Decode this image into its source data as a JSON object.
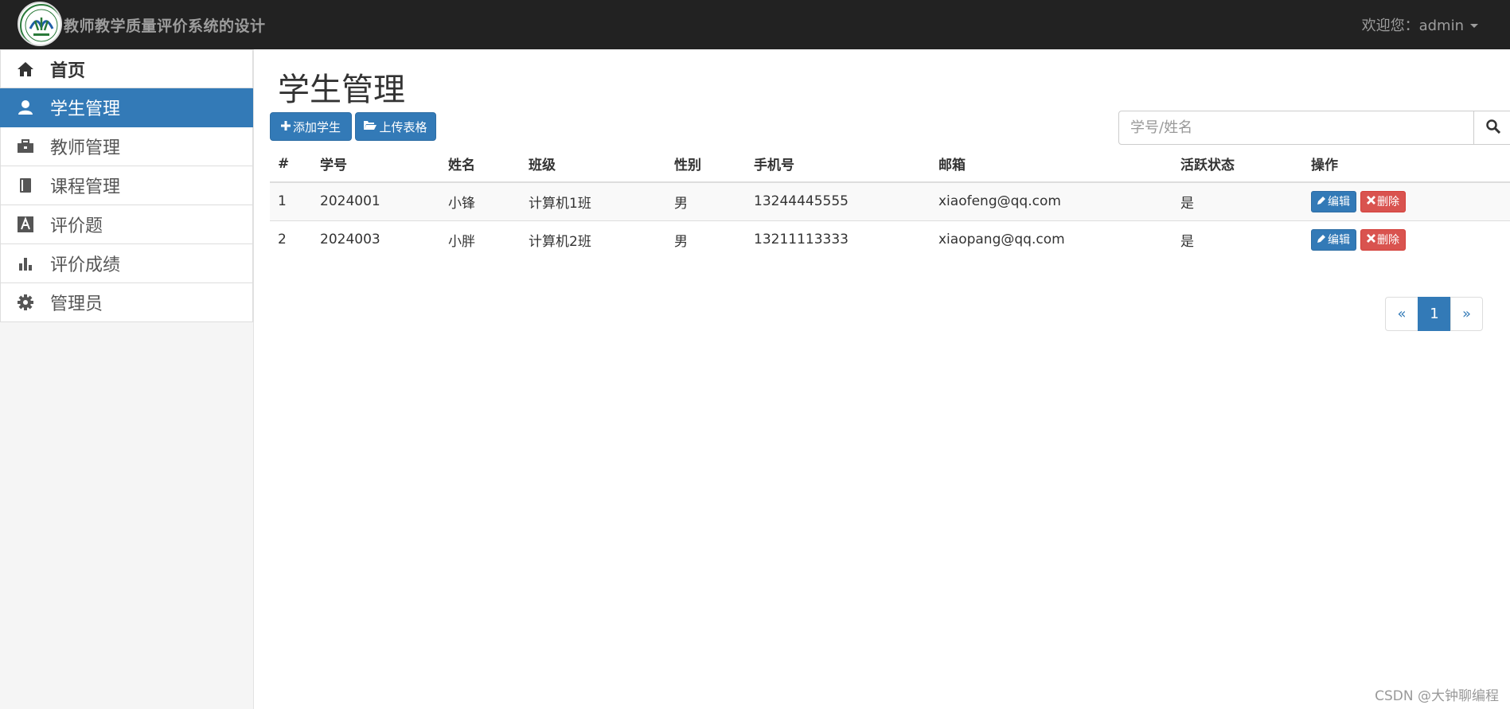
{
  "app": {
    "title": "教师教学质量评价系统的设计",
    "user_greeting": "欢迎您：admin"
  },
  "sidebar": {
    "items": [
      {
        "label": "首页",
        "icon": "home-icon"
      },
      {
        "label": "学生管理",
        "icon": "user-icon"
      },
      {
        "label": "教师管理",
        "icon": "briefcase-icon"
      },
      {
        "label": "课程管理",
        "icon": "book-icon"
      },
      {
        "label": "评价题",
        "icon": "font-icon"
      },
      {
        "label": "评价成绩",
        "icon": "bar-chart-icon"
      },
      {
        "label": "管理员",
        "icon": "gear-icon"
      }
    ],
    "active_index": 1
  },
  "main": {
    "title": "学生管理",
    "add_button": "添加学生",
    "upload_button": "上传表格",
    "search_placeholder": "学号/姓名"
  },
  "table": {
    "headers": [
      "#",
      "学号",
      "姓名",
      "班级",
      "性别",
      "手机号",
      "邮箱",
      "活跃状态",
      "操作"
    ],
    "rows": [
      {
        "idx": "1",
        "sid": "2024001",
        "name": "小锋",
        "class": "计算机1班",
        "gender": "男",
        "phone": "13244445555",
        "email": "xiaofeng@qq.com",
        "active": "是"
      },
      {
        "idx": "2",
        "sid": "2024003",
        "name": "小胖",
        "class": "计算机2班",
        "gender": "男",
        "phone": "13211113333",
        "email": "xiaopang@qq.com",
        "active": "是"
      }
    ],
    "edit_label": "编辑",
    "delete_label": "删除"
  },
  "pagination": {
    "prev": "«",
    "current": "1",
    "next": "»"
  },
  "watermark": "CSDN @大钟聊编程",
  "colors": {
    "navbar": "#222222",
    "primary": "#337ab7",
    "danger": "#d9534f"
  }
}
